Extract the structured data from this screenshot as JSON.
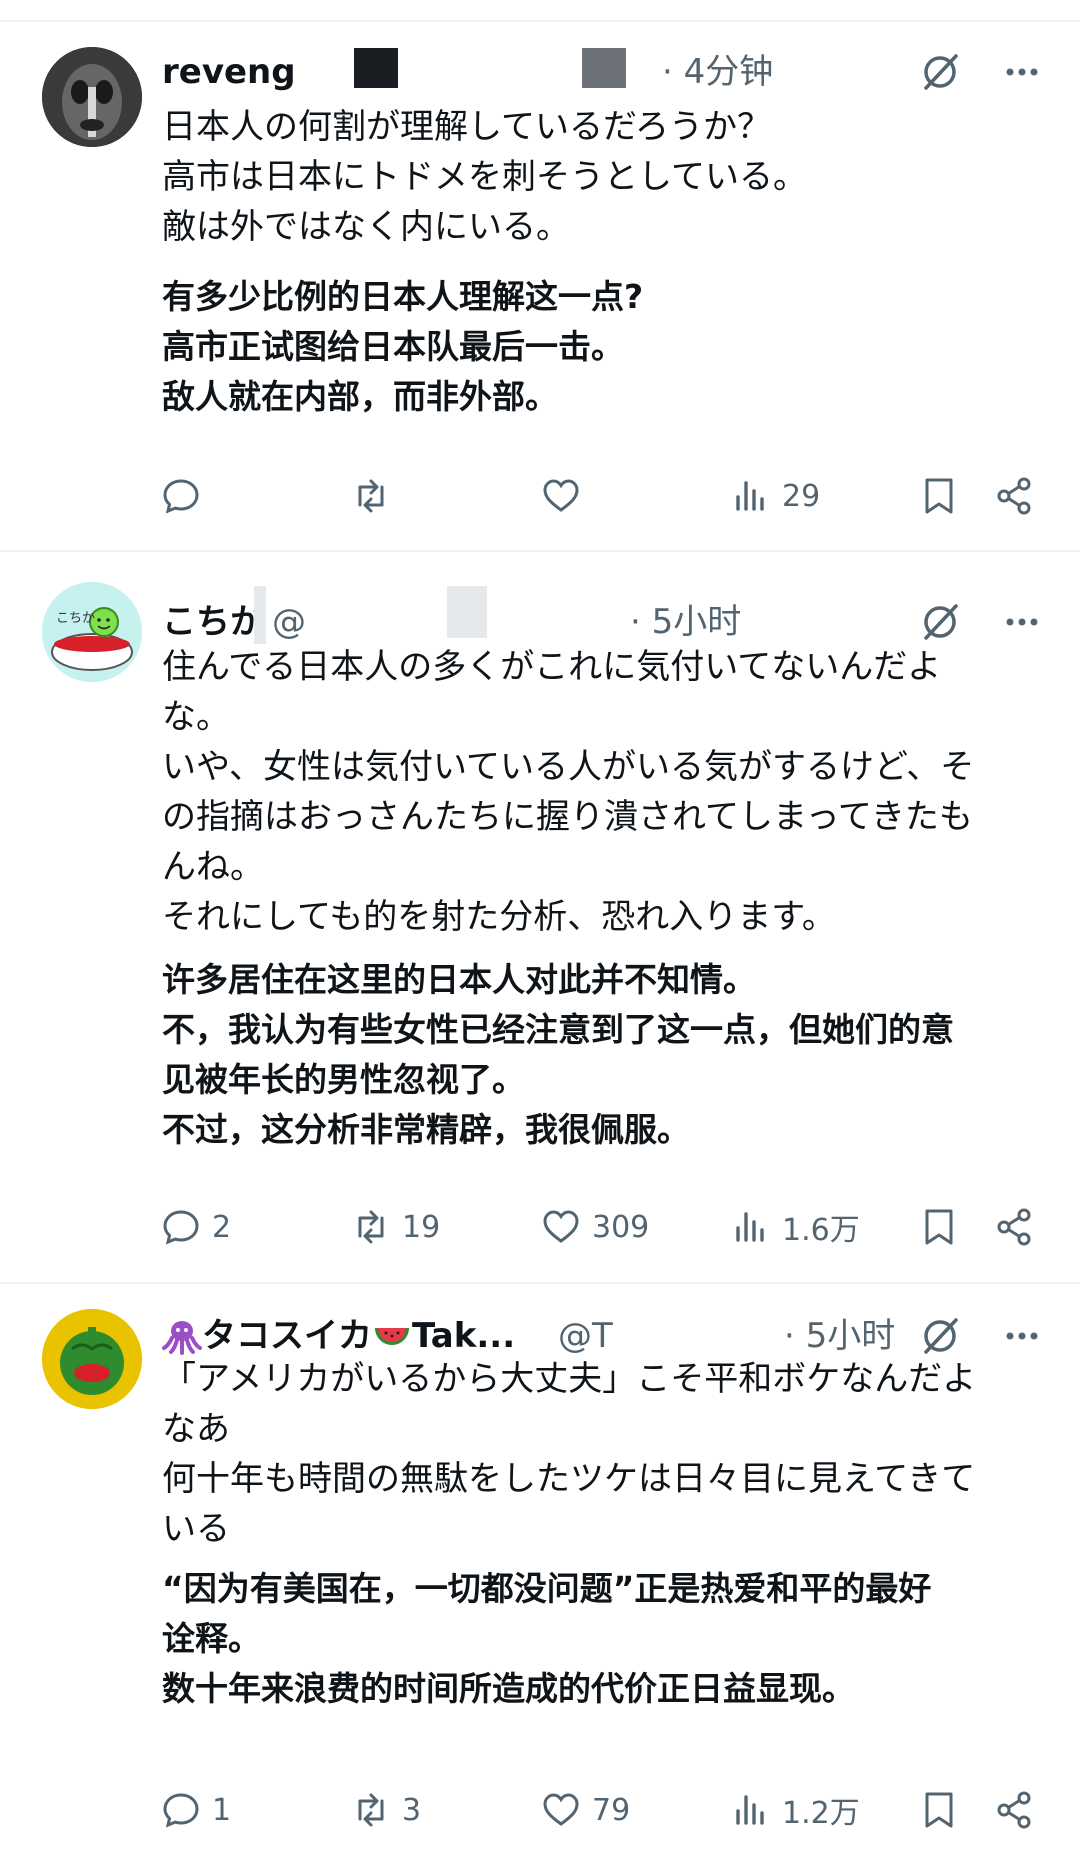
{
  "posts": [
    {
      "name": "reveng",
      "handle": "",
      "time": "· 4分钟",
      "jp_lines": [
        "日本人の何割が理解しているだろうか？",
        "高市は日本にトドメを刺そうとしている。",
        "敵は外ではなく内にいる。"
      ],
      "zh_lines": [
        "有多少比例的日本人理解这一点?",
        "高市正试图给日本队最后一击。",
        "敌人就在内部，而非外部。"
      ],
      "actions": {
        "reply": "",
        "retweet": "",
        "like": "",
        "views": "29"
      }
    },
    {
      "name": "こちか",
      "handle": "@",
      "time": "· 5小时",
      "avatar_text": "こちか",
      "jp_lines": [
        "住んでる日本人の多くがこれに気付いてないんだよ",
        "な。",
        "いや、女性は気付いている人がいる気がするけど、そ",
        "の指摘はおっさんたちに握り潰されてしまってきたも",
        "んね。",
        "それにしても的を射た分析、恐れ入ります。"
      ],
      "zh_lines": [
        "许多居住在这里的日本人对此并不知情。",
        "不，我认为有些女性已经注意到了这一点，但她们的意",
        "见被年长的男性忽视了。",
        "不过，这分析非常精辟，我很佩服。"
      ],
      "actions": {
        "reply": "2",
        "retweet": "19",
        "like": "309",
        "views": "1.6万"
      }
    },
    {
      "name": "タコスイカ",
      "name_suffix": "Tak...",
      "handle": "@T",
      "time": "· 5小时",
      "jp_lines": [
        "「アメリカがいるから大丈夫」こそ平和ボケなんだよ",
        "なあ",
        "何十年も時間の無駄をしたツケは日々目に見えてきて",
        "いる"
      ],
      "zh_lines": [
        "“因为有美国在，一切都没问题”正是热爱和平的最好",
        "诠释。",
        "数十年来浪费的时间所造成的代价正日益显现。"
      ],
      "actions": {
        "reply": "1",
        "retweet": "3",
        "like": "79",
        "views": "1.2万"
      }
    }
  ],
  "icons": [
    "reply-icon",
    "retweet-icon",
    "like-icon",
    "views-icon",
    "bookmark-icon",
    "share-icon",
    "grok-icon",
    "more-icon"
  ],
  "colors": {
    "text": "#0f1419",
    "secondary": "#536471",
    "divider": "#eff3f4"
  }
}
